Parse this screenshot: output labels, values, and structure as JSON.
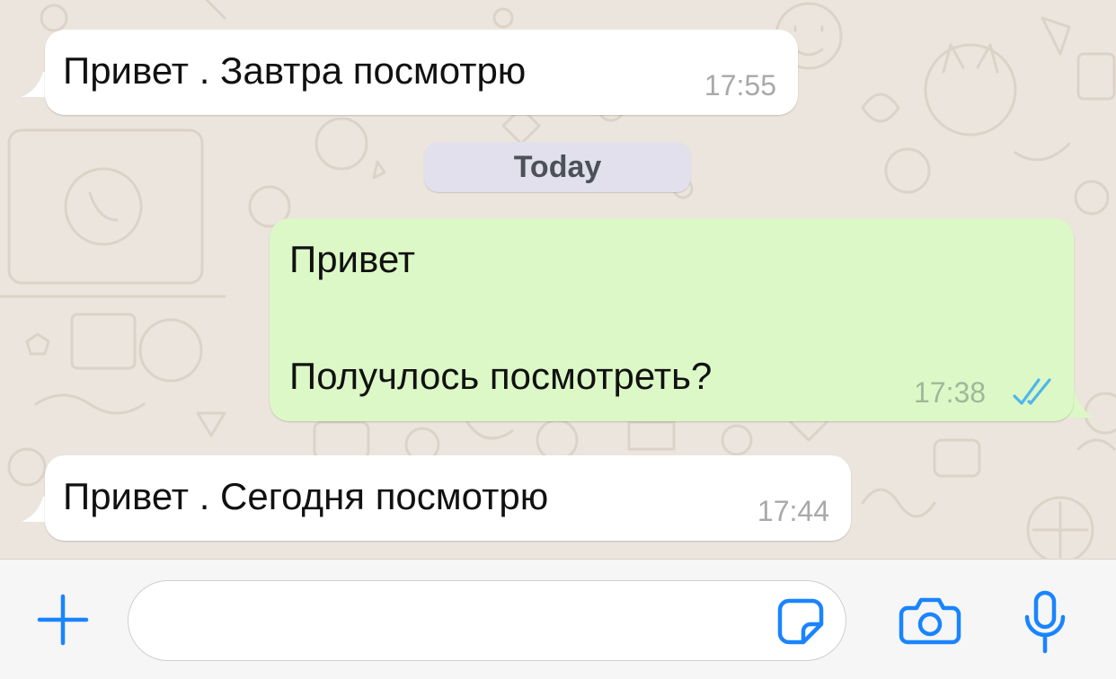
{
  "colors": {
    "chat_background": "#ece5dd",
    "incoming_bubble": "#ffffff",
    "outgoing_bubble": "#dcf8c6",
    "accent_blue": "#1a84ff",
    "read_ticks": "#4fb6ec",
    "day_chip": "#e1e0ec"
  },
  "messages": [
    {
      "direction": "incoming",
      "text": "Привет . Завтра посмотрю",
      "time": "17:55"
    },
    {
      "direction": "outgoing",
      "text_line1": "Привет",
      "text_line2": "Получлось посмотреть?",
      "time": "17:38",
      "status": "read"
    },
    {
      "direction": "incoming",
      "text": "Привет . Сегодня посмотрю",
      "time": "17:44"
    }
  ],
  "day_separator": "Today",
  "input_bar": {
    "attach_icon": "plus-icon",
    "message_placeholder": "",
    "sticker_icon": "sticker-icon",
    "camera_icon": "camera-icon",
    "mic_icon": "microphone-icon"
  }
}
